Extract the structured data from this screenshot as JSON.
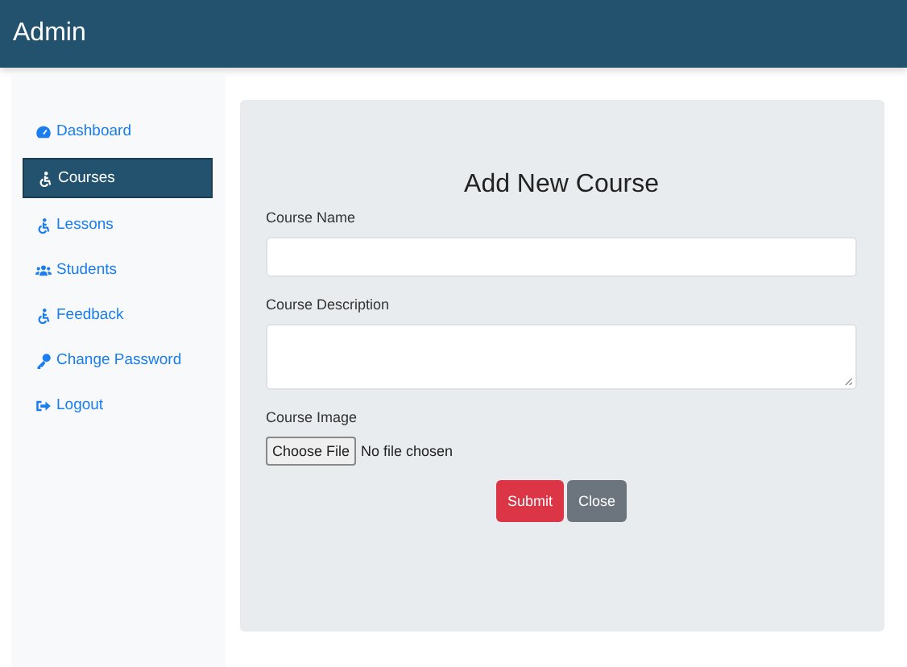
{
  "header": {
    "title": "Admin"
  },
  "sidebar": {
    "items": [
      {
        "label": "Dashboard",
        "selected": false
      },
      {
        "label": "Courses",
        "selected": true
      },
      {
        "label": "Lessons",
        "selected": false
      },
      {
        "label": "Students",
        "selected": false
      },
      {
        "label": "Feedback",
        "selected": false
      },
      {
        "label": "Change Password",
        "selected": false
      },
      {
        "label": "Logout",
        "selected": false
      }
    ]
  },
  "form": {
    "title": "Add New Course",
    "fields": [
      {
        "label": "Course Name",
        "kind": "text"
      },
      {
        "label": "Course Description",
        "kind": "textarea"
      },
      {
        "label": "Course Image",
        "kind": "file",
        "button": "Choose File",
        "status": "No file chosen"
      }
    ],
    "buttons": [
      {
        "label": "Submit",
        "kind": "danger"
      },
      {
        "label": "Close",
        "kind": "secondary"
      }
    ]
  }
}
